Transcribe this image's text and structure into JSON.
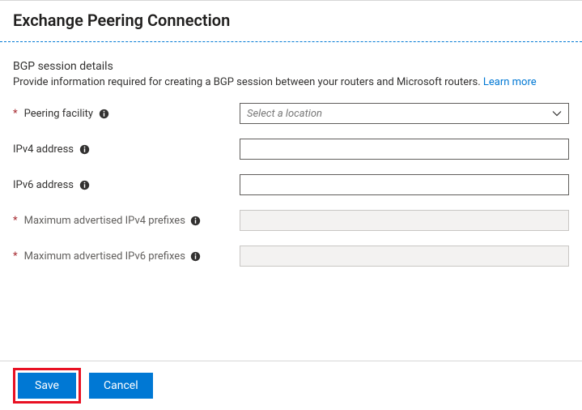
{
  "header": {
    "title": "Exchange Peering Connection"
  },
  "section": {
    "title": "BGP session details",
    "description": "Provide information required for creating a BGP session between your routers and Microsoft routers.",
    "learn_more_label": "Learn more"
  },
  "fields": {
    "peering_facility": {
      "label": "Peering facility",
      "required": true,
      "placeholder": "Select a location",
      "value": ""
    },
    "ipv4_address": {
      "label": "IPv4 address",
      "required": false,
      "value": ""
    },
    "ipv6_address": {
      "label": "IPv6 address",
      "required": false,
      "value": ""
    },
    "max_ipv4_prefixes": {
      "label": "Maximum advertised IPv4 prefixes",
      "required": true,
      "value": "",
      "disabled": true
    },
    "max_ipv6_prefixes": {
      "label": "Maximum advertised IPv6 prefixes",
      "required": true,
      "value": "",
      "disabled": true
    }
  },
  "footer": {
    "save_label": "Save",
    "cancel_label": "Cancel"
  },
  "colors": {
    "accent": "#0078d4",
    "highlight_ring": "#e81123"
  }
}
